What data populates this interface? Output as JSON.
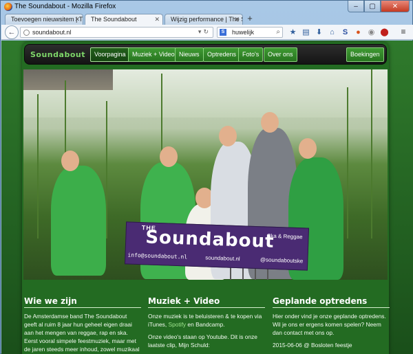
{
  "browser": {
    "window_title": "The Soundabout - Mozilla Firefox",
    "controls": {
      "minimize": "–",
      "maximize": "▢",
      "close": "✕"
    },
    "tabs": [
      {
        "label": "Toevoegen nieuwsitem | The So..."
      },
      {
        "label": "The Soundabout"
      },
      {
        "label": "Wijzig performance | The Sound..."
      }
    ],
    "url": "soundabout.nl",
    "search_value": "huwelijk",
    "search_engine": "S"
  },
  "site": {
    "logo": "Soundabout",
    "nav": [
      {
        "label": "Voorpagina"
      },
      {
        "label": "Muziek + Video"
      },
      {
        "label": "Nieuws"
      },
      {
        "label": "Optredens"
      },
      {
        "label": "Foto's"
      },
      {
        "label": "Over ons"
      }
    ],
    "nav_right": "Boekingen",
    "banner": {
      "the": "THE",
      "title": "Soundabout",
      "genre": "Ska & Reggae",
      "email": "info@soundabout.nl",
      "site": "soundabout.nl",
      "handle": "@soundaboutske"
    },
    "columns": [
      {
        "heading": "Wie we zijn",
        "text": "De Amsterdamse band The Soundabout geeft al ruim 8 jaar hun geheel eigen draai aan het mengen van reggae, rap en ska. Eerst vooral simpele feestmuziek, maar met de jaren steeds meer inhoud, zowel muzikaal als tekstueel."
      },
      {
        "heading": "Muziek + Video",
        "text_a": "Onze muziek is te beluisteren & te kopen via iTunes, ",
        "link": "Spotify",
        "text_b": " en Bandcamp.",
        "text_c": "Onze video's staan op Youtube. Dit is onze laatste clip, Mijn Schuld:"
      },
      {
        "heading": "Geplande optredens",
        "text": "Hier onder vind je onze geplande optredens. Wil je ons er ergens komen spelen? Neem dan contact met ons op.",
        "event": "2015-06-06 @ Bosloten feestje"
      }
    ]
  },
  "colors": {
    "accent_green": "#3f9a33",
    "background_green": "#236b22",
    "banner_purple": "#4a2b73"
  }
}
